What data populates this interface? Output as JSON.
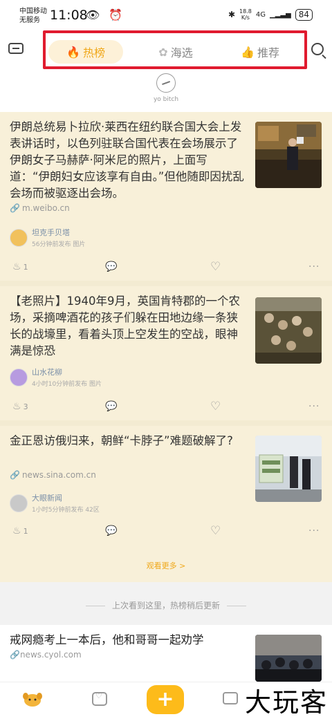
{
  "status_bar": {
    "carrier_line1": "中国移动",
    "carrier_line2": "无服务",
    "time": "11:08",
    "left_icons": "👁 ⏰",
    "bluetooth": "✱",
    "speed_top": "18.8",
    "speed_bottom": "K/s",
    "network": "4G",
    "signal": "▁▂▃▅",
    "battery": "84"
  },
  "header": {
    "tabs": [
      {
        "label": "热榜",
        "icon": "hot-icon",
        "active": true
      },
      {
        "label": "海选",
        "icon": "shell-icon",
        "active": false
      },
      {
        "label": "推荐",
        "icon": "thumbs-up-icon",
        "active": false
      }
    ],
    "yo_label": "yo bitch"
  },
  "feed": [
    {
      "title": "伊朗总统易卜拉欣·莱西在纽约联合国大会上发表讲话时，以色列驻联合国代表在会场展示了伊朗女子马赫萨·阿米尼的照片，上面写道：“伊朗妇女应该享有自由。”但他随即因扰乱会场而被驱逐出会场。",
      "source": "m.weibo.cn",
      "author": "坦克手贝塔",
      "meta": "56分钟前发布  图片",
      "likes": "1"
    },
    {
      "title": "【老照片】1940年9月，英国肯特郡的一个农场，采摘啤酒花的孩子们躲在田地边缘一条狭长的战壕里，看着头顶上空发生的空战，眼神满是惊恐",
      "source": "",
      "author": "山水花柳",
      "meta": "4小时10分钟前发布  图片",
      "likes": "3"
    },
    {
      "title": "金正恩访俄归来，朝鲜“卡脖子”难题破解了?",
      "source": "news.sina.com.cn",
      "author": "大眼新闻",
      "meta": "1小时5分钟前发布  42区",
      "likes": "1"
    }
  ],
  "view_more": "观看更多 >",
  "last_seen": "上次看到这里，热榜稍后更新",
  "next_card": {
    "title": "戒网瘾考上一本后，他和哥哥一起劝学",
    "source": "news.cyol.com"
  },
  "bottom_nav": {
    "add_label": "+"
  },
  "watermark": "大玩客",
  "colors": {
    "accent": "#f0a81a",
    "feed_bg": "#f8f0d9",
    "highlight_box": "#e01b2f",
    "author_name": "#7a8fa8"
  }
}
